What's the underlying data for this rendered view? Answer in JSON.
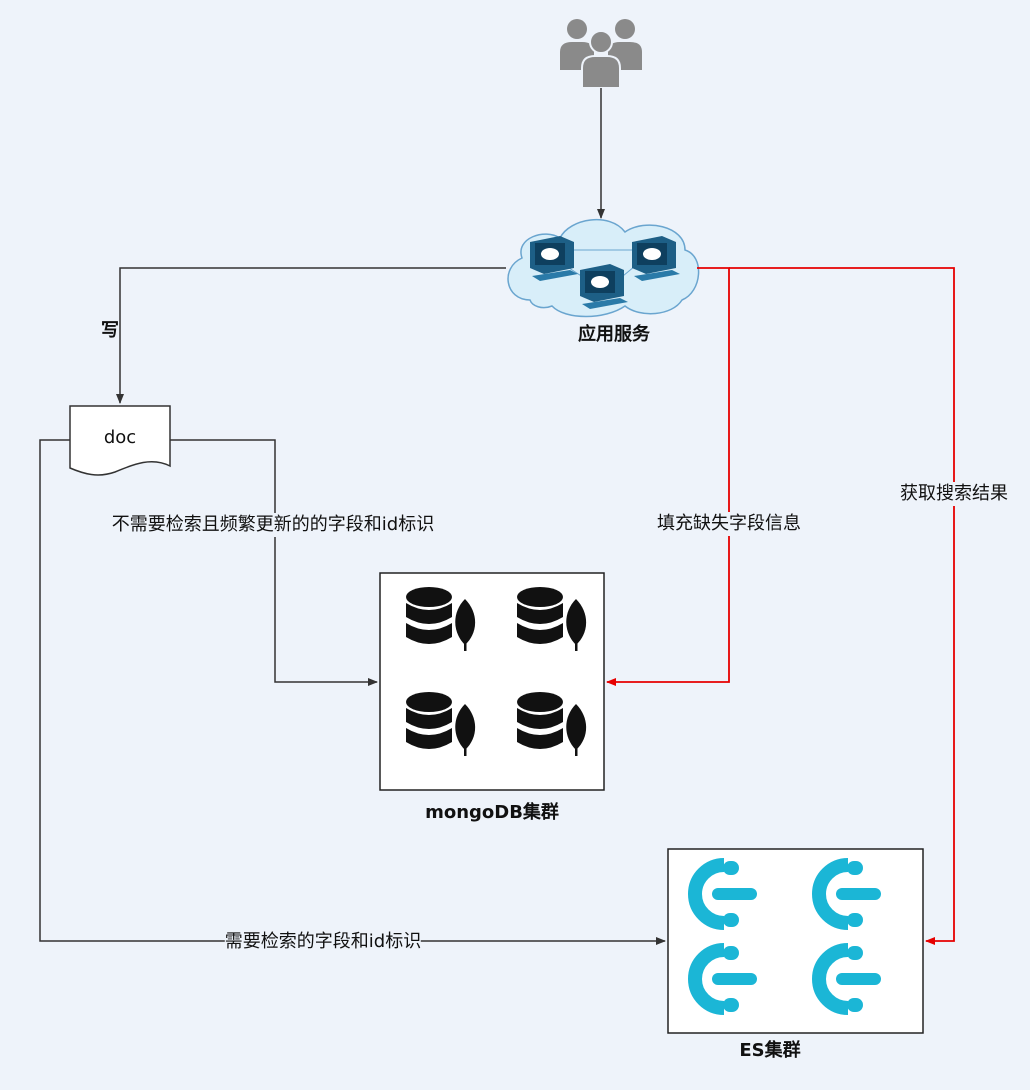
{
  "nodes": {
    "users": {
      "icon": "users-group-icon"
    },
    "app": {
      "icon": "cloud-network-icon",
      "label": "应用服务"
    },
    "doc": {
      "icon": "document-icon",
      "label": "doc"
    },
    "mongo": {
      "icon": "mongodb-database-icon",
      "label": "mongoDB集群",
      "instances": 4
    },
    "es": {
      "icon": "elasticsearch-icon",
      "label": "ES集群",
      "instances": 4
    }
  },
  "edges": {
    "write": {
      "from": "app",
      "to": "doc",
      "label": "写"
    },
    "doc_to_mongo": {
      "from": "doc",
      "to": "mongo",
      "label": "不需要检索且频繁更新的的字段和id标识"
    },
    "doc_to_es": {
      "from": "doc",
      "to": "es",
      "label": "需要检索的字段和id标识"
    },
    "app_to_mongo": {
      "from": "app",
      "to": "mongo",
      "label": "填充缺失字段信息"
    },
    "app_to_es": {
      "from": "app",
      "to": "es",
      "label": "获取搜索结果"
    },
    "users_to_app": {
      "from": "users",
      "to": "app",
      "label": ""
    }
  },
  "colors": {
    "background": "#eef3fa",
    "line": "#333333",
    "highlight": "#e60000",
    "mongo_icon": "#111111",
    "es_icon": "#1bb6d6",
    "user_icon": "#8a8a8a",
    "computer": "#1d5f86",
    "cloud_fill": "#d8eef9",
    "cloud_stroke": "#6aa5cf"
  }
}
